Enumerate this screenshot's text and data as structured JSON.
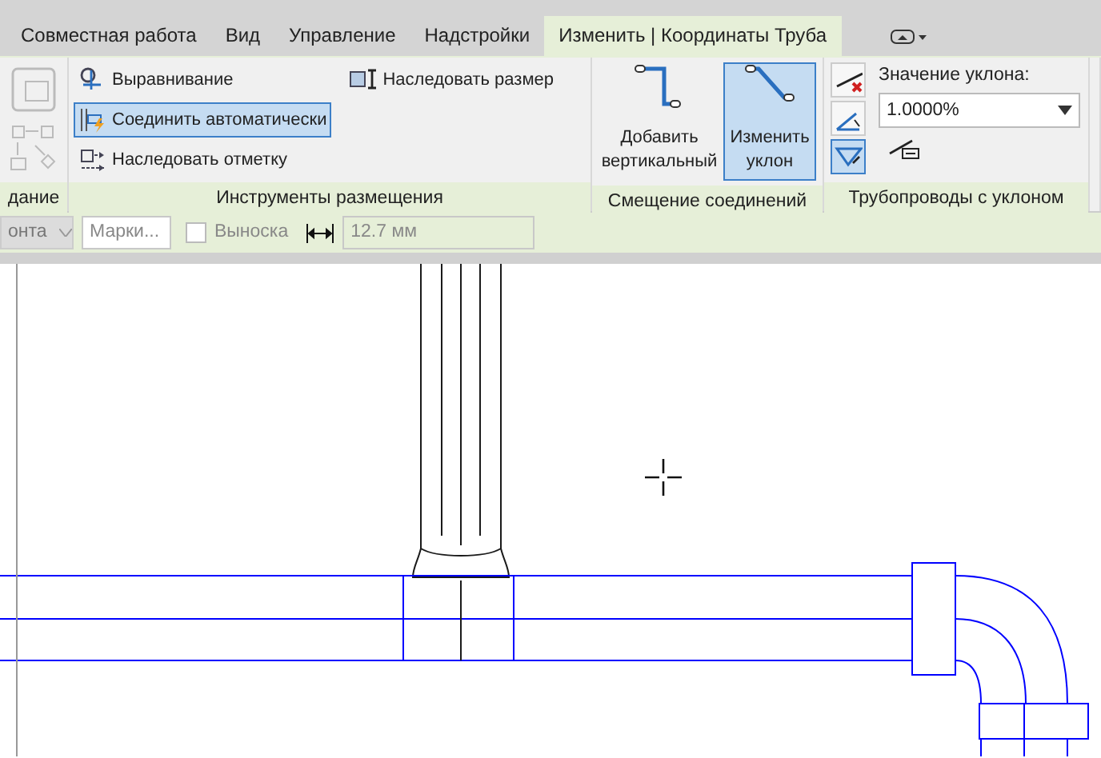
{
  "tabs": [
    {
      "label": "Совместная работа",
      "selected": false
    },
    {
      "label": "Вид",
      "selected": false
    },
    {
      "label": "Управление",
      "selected": false
    },
    {
      "label": "Надстройки",
      "selected": false
    },
    {
      "label": "Изменить | Координаты Труба",
      "selected": true
    }
  ],
  "panels": [
    {
      "label": "дание"
    },
    {
      "label": "Инструменты размещения",
      "tools": [
        {
          "kind": "align",
          "label": "Выравнивание",
          "selected": false
        },
        {
          "kind": "autoconnect",
          "label": "Соединить автоматически",
          "selected": true
        },
        {
          "kind": "inherit-elevation",
          "label": "Наследовать отметку",
          "selected": false
        },
        {
          "kind": "inherit-size",
          "label": "Наследовать размер",
          "selected": false
        }
      ]
    },
    {
      "label": "Смещение соединений",
      "tools": [
        {
          "kind": "add-vertical",
          "label": "Добавить вертикальный",
          "selected": false
        },
        {
          "kind": "change-slope",
          "label": "Изменить уклон",
          "selected": true
        }
      ]
    },
    {
      "label": "Трубопроводы с уклоном",
      "tools": [
        {
          "kind": "remove-slope",
          "selected": false
        },
        {
          "kind": "slope-up",
          "selected": false
        },
        {
          "kind": "slope-down",
          "selected": true
        }
      ],
      "slope_label": "Значение уклона:",
      "slope_value": "1.0000%"
    }
  ],
  "options_bar": {
    "dropdown": "онта",
    "mark": "Марки...",
    "leader": {
      "label": "Выноска",
      "checked": false
    },
    "offset": "12.7 мм"
  }
}
